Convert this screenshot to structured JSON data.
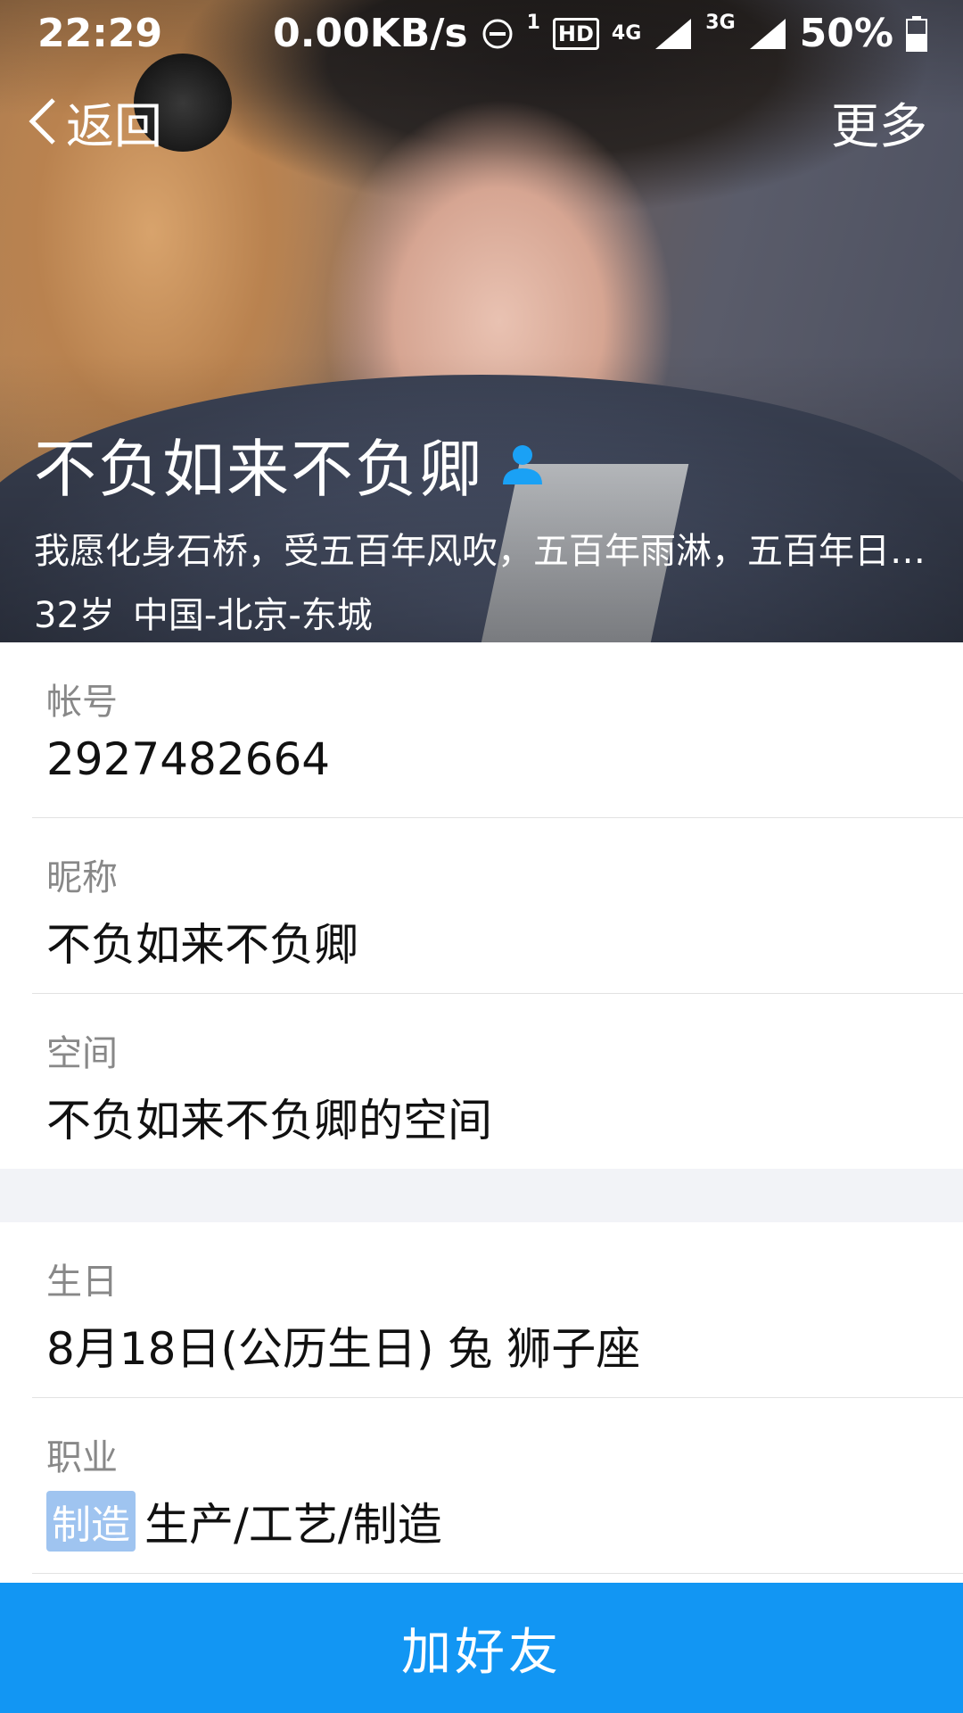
{
  "status_bar": {
    "time": "22:29",
    "net_speed": "0.00KB/s",
    "sim1": "1",
    "hd": "HD",
    "net1": "4G",
    "net2": "3G",
    "battery": "50%"
  },
  "nav": {
    "back_label": "返回",
    "more_label": "更多"
  },
  "profile": {
    "name": "不负如来不负卿",
    "signature": "我愿化身石桥，受五百年风吹，五百年雨淋，五百年日晒，只求她从桥上走过",
    "age": "32岁",
    "location": "中国-北京-东城"
  },
  "details": [
    {
      "label": "帐号",
      "value": "2927482664"
    },
    {
      "label": "昵称",
      "value": "不负如来不负卿"
    },
    {
      "label": "空间",
      "value": "不负如来不负卿的空间"
    }
  ],
  "details2": {
    "birthday": {
      "label": "生日",
      "value": "8月18日(公历生日) 兔 狮子座"
    },
    "job": {
      "label": "职业",
      "tag": "制造",
      "value": "生产/工艺/制造"
    }
  },
  "action": {
    "add_friend": "加好友"
  },
  "colors": {
    "accent": "#1296F3",
    "tag_bg": "#9FC4F0",
    "person_icon": "#1AA1F5"
  }
}
